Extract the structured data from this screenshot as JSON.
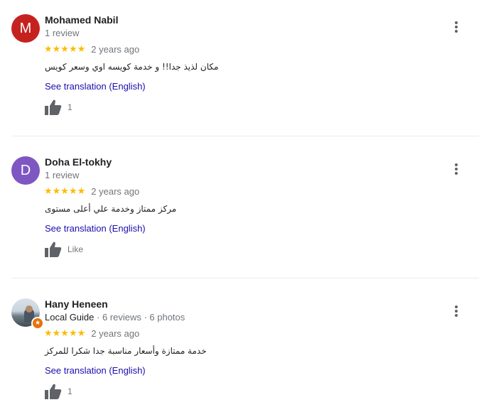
{
  "reviews": [
    {
      "avatar_letter": "M",
      "avatar_color": "#c5221f",
      "name": "Mohamed Nabil",
      "sub": "1 review",
      "stars": "★★★★★",
      "rating": 5,
      "date": "2 years ago",
      "text": "مكان لذيذ جدا!! و خدمة كويسه اوي وسعر كويس",
      "translate": "See translation (English)",
      "likes": "1"
    },
    {
      "avatar_letter": "D",
      "avatar_color": "#7e57c2",
      "name": "Doha El-tokhy",
      "sub": "1 review",
      "stars": "★★★★★",
      "rating": 5,
      "date": "2 years ago",
      "text": "مركز ممتاز وخدمة  علي أعلى مستوى",
      "translate": "See translation (English)",
      "likes": "Like"
    },
    {
      "avatar_letter": "",
      "avatar_color": "#8a9aa5",
      "name": "Hany Heneen",
      "local_guide": "Local Guide",
      "sub": " · 6 reviews · 6 photos",
      "stars": "★★★★★",
      "rating": 5,
      "date": "2 years ago",
      "text": "خدمة ممتازة وأسعار مناسبة جدا شكرا للمركز",
      "translate": "See translation (English)",
      "likes": "1"
    }
  ],
  "icons": {
    "menu": "more-vert-icon",
    "like": "thumb-up-icon",
    "badge": "local-guide-star-icon"
  },
  "colors": {
    "star": "#fbbc04",
    "link": "#1a0dab",
    "secondary_text": "#70757a",
    "local_guide_badge": "#e8710a"
  }
}
